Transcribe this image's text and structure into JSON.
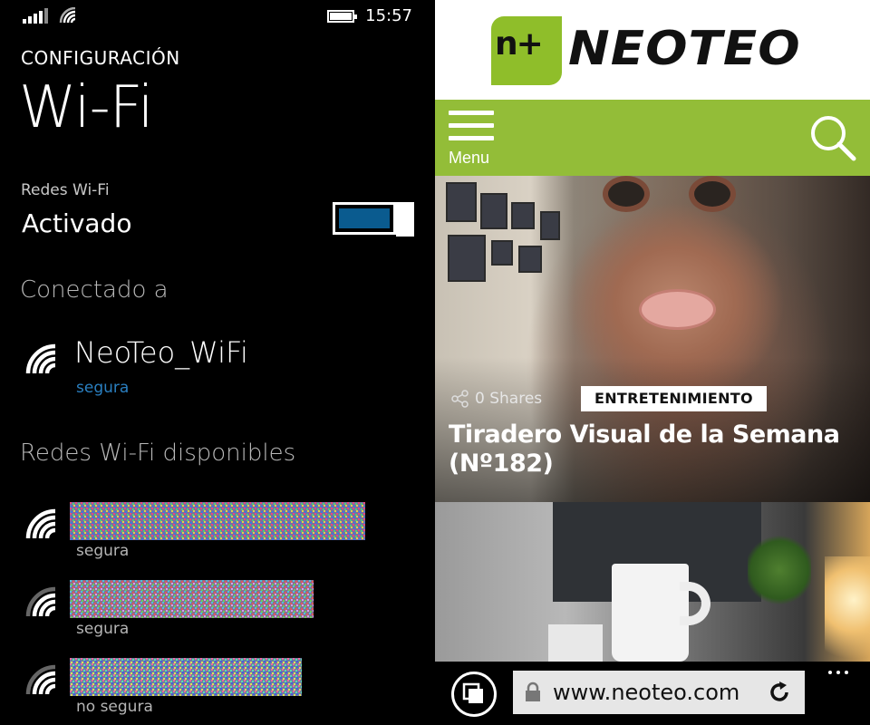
{
  "status_bar": {
    "time": "15:57",
    "icons": [
      "cell-signal-icon",
      "wifi-icon",
      "battery-icon"
    ]
  },
  "settings": {
    "section_label": "CONFIGURACIÓN",
    "title": "Wi-Fi",
    "toggle": {
      "label": "Redes Wi-Fi",
      "state": "Activado",
      "on": true
    },
    "connected_heading": "Conectado a",
    "connected_network": {
      "name": "NeoTeo_WiFi",
      "security": "segura"
    },
    "available_heading": "Redes Wi-Fi disponibles",
    "available_networks": [
      {
        "name_hidden": true,
        "security": "segura",
        "strength": "full"
      },
      {
        "name_hidden": true,
        "security": "segura",
        "strength": "medium"
      },
      {
        "name_hidden": true,
        "security": "no segura",
        "strength": "medium"
      }
    ],
    "colors": {
      "accent": "#2a7fc0",
      "toggle_fill": "#0a5b8f"
    }
  },
  "browser": {
    "site_logo": {
      "badge_text": "n+",
      "wordmark": "NEOTEO"
    },
    "nav": {
      "menu_label": "Menu"
    },
    "article": {
      "shares": "0 Shares",
      "category": "ENTRETENIMIENTO",
      "headline": "Tiradero Visual de la Semana (Nº182)"
    },
    "address_bar": {
      "url": "www.neoteo.com"
    },
    "colors": {
      "brand_green": "#93bd38"
    }
  }
}
